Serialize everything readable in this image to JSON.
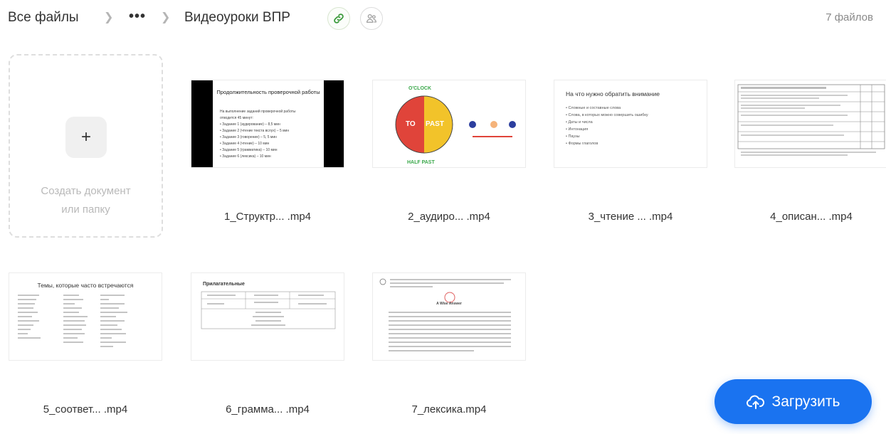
{
  "breadcrumb": {
    "root": "Все файлы",
    "separator": ">",
    "more": "•••",
    "current": "Видеоуроки ВПР"
  },
  "header": {
    "link_icon": "link-icon",
    "share_icon": "share-users-icon",
    "file_count": "7 файлов"
  },
  "create": {
    "plus": "+",
    "label_line1": "Создать документ",
    "label_line2": "или папку"
  },
  "files": [
    {
      "name": "1_Структр... .mp4"
    },
    {
      "name": "2_аудиро... .mp4"
    },
    {
      "name": "3_чтение ... .mp4"
    },
    {
      "name": "4_описан... .mp4"
    },
    {
      "name": "5_соответ... .mp4"
    },
    {
      "name": "6_грамма... .mp4"
    },
    {
      "name": "7_лексика.mp4"
    }
  ],
  "thumbs": {
    "t1": {
      "title": "Продолжительность проверочной работы",
      "lines": [
        "На выполнение заданий проверочной работы",
        "отводится 45 минут:",
        "• Задание 1 (аудирование) – 8,5 мин",
        "• Задание 2 (чтение текста вслух) – 5 мин",
        "• Задание 3 (говорение) – 5, 5 мин",
        "• Задание 4 (чтение) – 10 мин",
        "• Задание 5 (грамматика) – 10 мин",
        "• Задание 6 (лексика) – 10 мин"
      ]
    },
    "t2": {
      "center_left": "TO",
      "center_right": "PAST",
      "top": "O'CLOCK",
      "bottom": "HALF PAST"
    },
    "t3": {
      "title": "На что нужно обратить внимание",
      "lines": [
        "• Сложные и составные слова",
        "• Слова, в которых можно совершить ошибку",
        "• Даты и числа",
        "• Интонация",
        "• Паузы",
        "• Формы глаголов"
      ]
    },
    "t5": {
      "title": "Темы, которые часто встречаются"
    },
    "t6": {
      "title": "Прилагательные"
    },
    "t7": {
      "title": "A Wise Answer"
    }
  },
  "upload": {
    "label": "Загрузить",
    "icon": "cloud-upload-icon"
  },
  "colors": {
    "accent": "#1a73f0",
    "link_green": "#3a9a3a"
  }
}
